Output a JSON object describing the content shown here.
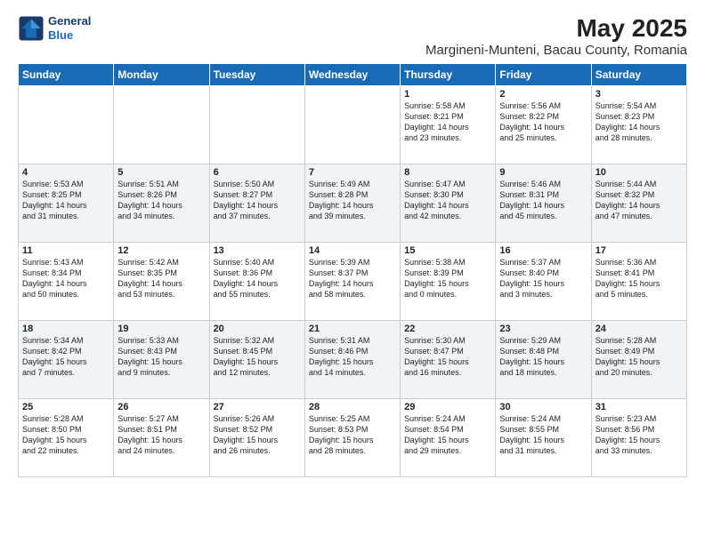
{
  "header": {
    "logo_line1": "General",
    "logo_line2": "Blue",
    "title": "May 2025",
    "subtitle": "Margineni-Munteni, Bacau County, Romania"
  },
  "weekdays": [
    "Sunday",
    "Monday",
    "Tuesday",
    "Wednesday",
    "Thursday",
    "Friday",
    "Saturday"
  ],
  "weeks": [
    [
      {
        "day": "",
        "content": ""
      },
      {
        "day": "",
        "content": ""
      },
      {
        "day": "",
        "content": ""
      },
      {
        "day": "",
        "content": ""
      },
      {
        "day": "1",
        "content": "Sunrise: 5:58 AM\nSunset: 8:21 PM\nDaylight: 14 hours\nand 23 minutes."
      },
      {
        "day": "2",
        "content": "Sunrise: 5:56 AM\nSunset: 8:22 PM\nDaylight: 14 hours\nand 25 minutes."
      },
      {
        "day": "3",
        "content": "Sunrise: 5:54 AM\nSunset: 8:23 PM\nDaylight: 14 hours\nand 28 minutes."
      }
    ],
    [
      {
        "day": "4",
        "content": "Sunrise: 5:53 AM\nSunset: 8:25 PM\nDaylight: 14 hours\nand 31 minutes."
      },
      {
        "day": "5",
        "content": "Sunrise: 5:51 AM\nSunset: 8:26 PM\nDaylight: 14 hours\nand 34 minutes."
      },
      {
        "day": "6",
        "content": "Sunrise: 5:50 AM\nSunset: 8:27 PM\nDaylight: 14 hours\nand 37 minutes."
      },
      {
        "day": "7",
        "content": "Sunrise: 5:49 AM\nSunset: 8:28 PM\nDaylight: 14 hours\nand 39 minutes."
      },
      {
        "day": "8",
        "content": "Sunrise: 5:47 AM\nSunset: 8:30 PM\nDaylight: 14 hours\nand 42 minutes."
      },
      {
        "day": "9",
        "content": "Sunrise: 5:46 AM\nSunset: 8:31 PM\nDaylight: 14 hours\nand 45 minutes."
      },
      {
        "day": "10",
        "content": "Sunrise: 5:44 AM\nSunset: 8:32 PM\nDaylight: 14 hours\nand 47 minutes."
      }
    ],
    [
      {
        "day": "11",
        "content": "Sunrise: 5:43 AM\nSunset: 8:34 PM\nDaylight: 14 hours\nand 50 minutes."
      },
      {
        "day": "12",
        "content": "Sunrise: 5:42 AM\nSunset: 8:35 PM\nDaylight: 14 hours\nand 53 minutes."
      },
      {
        "day": "13",
        "content": "Sunrise: 5:40 AM\nSunset: 8:36 PM\nDaylight: 14 hours\nand 55 minutes."
      },
      {
        "day": "14",
        "content": "Sunrise: 5:39 AM\nSunset: 8:37 PM\nDaylight: 14 hours\nand 58 minutes."
      },
      {
        "day": "15",
        "content": "Sunrise: 5:38 AM\nSunset: 8:39 PM\nDaylight: 15 hours\nand 0 minutes."
      },
      {
        "day": "16",
        "content": "Sunrise: 5:37 AM\nSunset: 8:40 PM\nDaylight: 15 hours\nand 3 minutes."
      },
      {
        "day": "17",
        "content": "Sunrise: 5:36 AM\nSunset: 8:41 PM\nDaylight: 15 hours\nand 5 minutes."
      }
    ],
    [
      {
        "day": "18",
        "content": "Sunrise: 5:34 AM\nSunset: 8:42 PM\nDaylight: 15 hours\nand 7 minutes."
      },
      {
        "day": "19",
        "content": "Sunrise: 5:33 AM\nSunset: 8:43 PM\nDaylight: 15 hours\nand 9 minutes."
      },
      {
        "day": "20",
        "content": "Sunrise: 5:32 AM\nSunset: 8:45 PM\nDaylight: 15 hours\nand 12 minutes."
      },
      {
        "day": "21",
        "content": "Sunrise: 5:31 AM\nSunset: 8:46 PM\nDaylight: 15 hours\nand 14 minutes."
      },
      {
        "day": "22",
        "content": "Sunrise: 5:30 AM\nSunset: 8:47 PM\nDaylight: 15 hours\nand 16 minutes."
      },
      {
        "day": "23",
        "content": "Sunrise: 5:29 AM\nSunset: 8:48 PM\nDaylight: 15 hours\nand 18 minutes."
      },
      {
        "day": "24",
        "content": "Sunrise: 5:28 AM\nSunset: 8:49 PM\nDaylight: 15 hours\nand 20 minutes."
      }
    ],
    [
      {
        "day": "25",
        "content": "Sunrise: 5:28 AM\nSunset: 8:50 PM\nDaylight: 15 hours\nand 22 minutes."
      },
      {
        "day": "26",
        "content": "Sunrise: 5:27 AM\nSunset: 8:51 PM\nDaylight: 15 hours\nand 24 minutes."
      },
      {
        "day": "27",
        "content": "Sunrise: 5:26 AM\nSunset: 8:52 PM\nDaylight: 15 hours\nand 26 minutes."
      },
      {
        "day": "28",
        "content": "Sunrise: 5:25 AM\nSunset: 8:53 PM\nDaylight: 15 hours\nand 28 minutes."
      },
      {
        "day": "29",
        "content": "Sunrise: 5:24 AM\nSunset: 8:54 PM\nDaylight: 15 hours\nand 29 minutes."
      },
      {
        "day": "30",
        "content": "Sunrise: 5:24 AM\nSunset: 8:55 PM\nDaylight: 15 hours\nand 31 minutes."
      },
      {
        "day": "31",
        "content": "Sunrise: 5:23 AM\nSunset: 8:56 PM\nDaylight: 15 hours\nand 33 minutes."
      }
    ]
  ]
}
